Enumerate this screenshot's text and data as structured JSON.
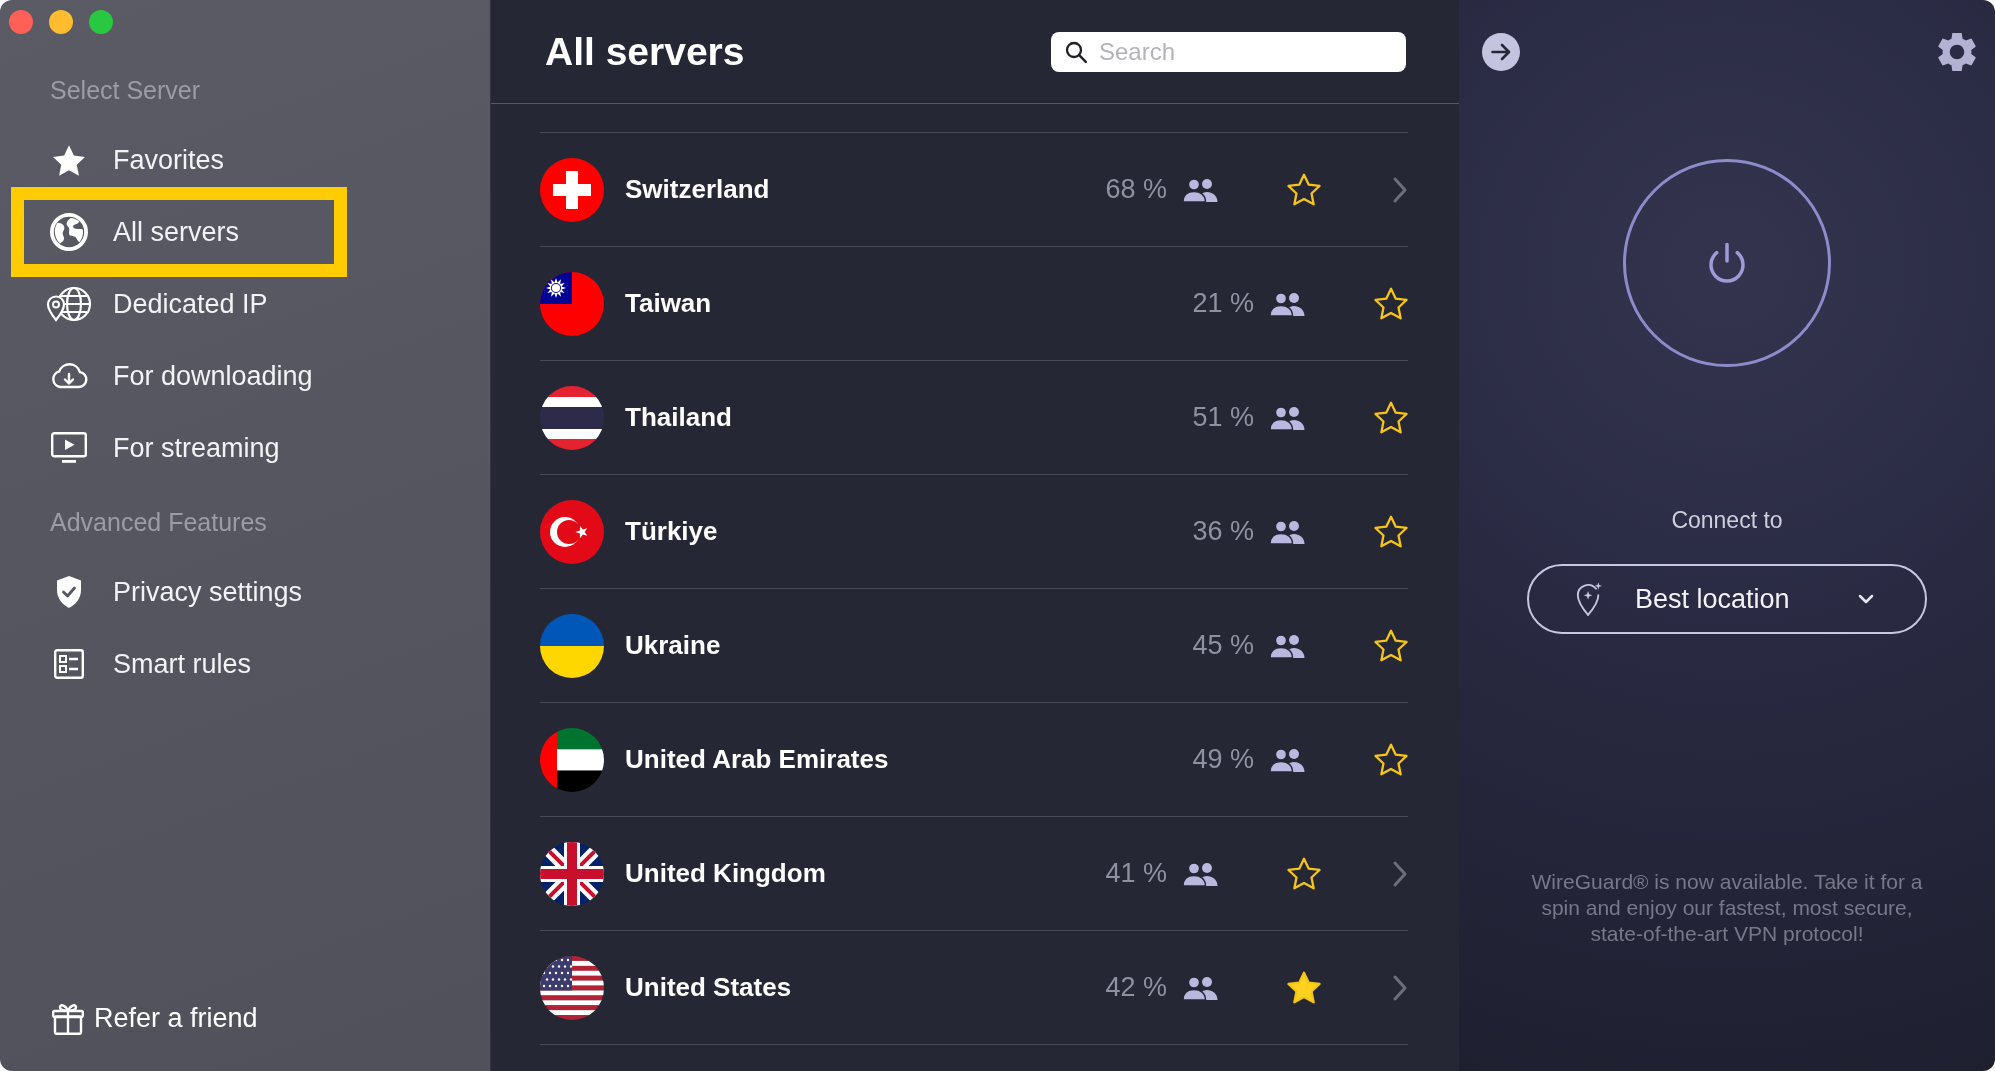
{
  "sidebar": {
    "sections": [
      {
        "heading": "Select Server",
        "items": [
          {
            "label": "Favorites",
            "selected": false
          },
          {
            "label": "All servers",
            "selected": true
          },
          {
            "label": "Dedicated IP",
            "selected": false
          },
          {
            "label": "For downloading",
            "selected": false
          },
          {
            "label": "For streaming",
            "selected": false
          }
        ]
      },
      {
        "heading": "Advanced Features",
        "items": [
          {
            "label": "Privacy settings",
            "selected": false
          },
          {
            "label": "Smart rules",
            "selected": false
          }
        ]
      }
    ],
    "footer_link": "Refer a friend"
  },
  "main": {
    "title": "All servers",
    "search": {
      "placeholder": "Search"
    },
    "servers": [
      {
        "name": "Switzerland",
        "load": "68 %",
        "favorite": false,
        "expandable": true
      },
      {
        "name": "Taiwan",
        "load": "21 %",
        "favorite": false,
        "expandable": false
      },
      {
        "name": "Thailand",
        "load": "51 %",
        "favorite": false,
        "expandable": false
      },
      {
        "name": "Türkiye",
        "load": "36 %",
        "favorite": false,
        "expandable": false
      },
      {
        "name": "Ukraine",
        "load": "45 %",
        "favorite": false,
        "expandable": false
      },
      {
        "name": "United Arab Emirates",
        "load": "49 %",
        "favorite": false,
        "expandable": false
      },
      {
        "name": "United Kingdom",
        "load": "41 %",
        "favorite": false,
        "expandable": true
      },
      {
        "name": "United States",
        "load": "42 %",
        "favorite": true,
        "expandable": true
      }
    ]
  },
  "connection": {
    "label": "Connect to",
    "location": "Best location",
    "notice": "WireGuard® is now available. Take it for a spin and enjoy our fastest, most secure, state-of-the-art VPN protocol!"
  }
}
